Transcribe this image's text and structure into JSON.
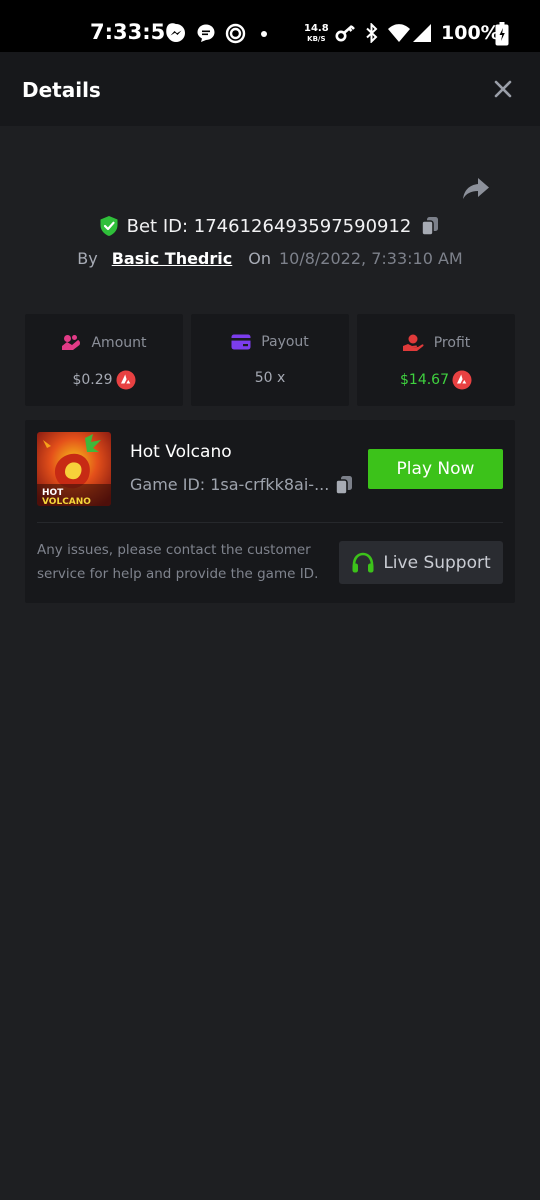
{
  "status_bar": {
    "time": "7:33:50",
    "net_speed_value": "14.8",
    "net_speed_unit": "KB/S",
    "battery": "100%",
    "icons": [
      "messenger-icon",
      "chat-icon",
      "app-icon",
      "dot-icon",
      "key-icon",
      "bluetooth-icon",
      "wifi-icon",
      "signal-icon",
      "battery-icon"
    ]
  },
  "header": {
    "title": "Details",
    "close_icon": "close-icon"
  },
  "bet": {
    "label": "Bet ID: 1746126493597590912",
    "by_label": "By",
    "user": "Basic Thedric",
    "on_label": "On",
    "date": "10/8/2022, 7:33:10 AM"
  },
  "stats": {
    "amount": {
      "label": "Amount",
      "value": "$0.29",
      "icon": "amount-icon",
      "color": "#e23b87"
    },
    "payout": {
      "label": "Payout",
      "value": "50 x",
      "icon": "card-icon",
      "color": "#7c3ded"
    },
    "profit": {
      "label": "Profit",
      "value": "$14.67",
      "icon": "profit-icon",
      "color": "#e03a3a"
    }
  },
  "game": {
    "name": "Hot Volcano",
    "id_text": "Game ID: 1sa-crfkk8ai-...",
    "thumb_title_line1": "HOT",
    "thumb_title_line2": "VOLCANO",
    "play_label": "Play Now",
    "help_text": "Any issues, please contact the customer service for help and provide the game ID.",
    "support_label": "Live Support"
  },
  "colors": {
    "accent_green": "#3cc21a",
    "profit_green": "#3fd13f",
    "coin_red": "#e84142",
    "background": "#1e1f22",
    "card": "#17181b"
  }
}
